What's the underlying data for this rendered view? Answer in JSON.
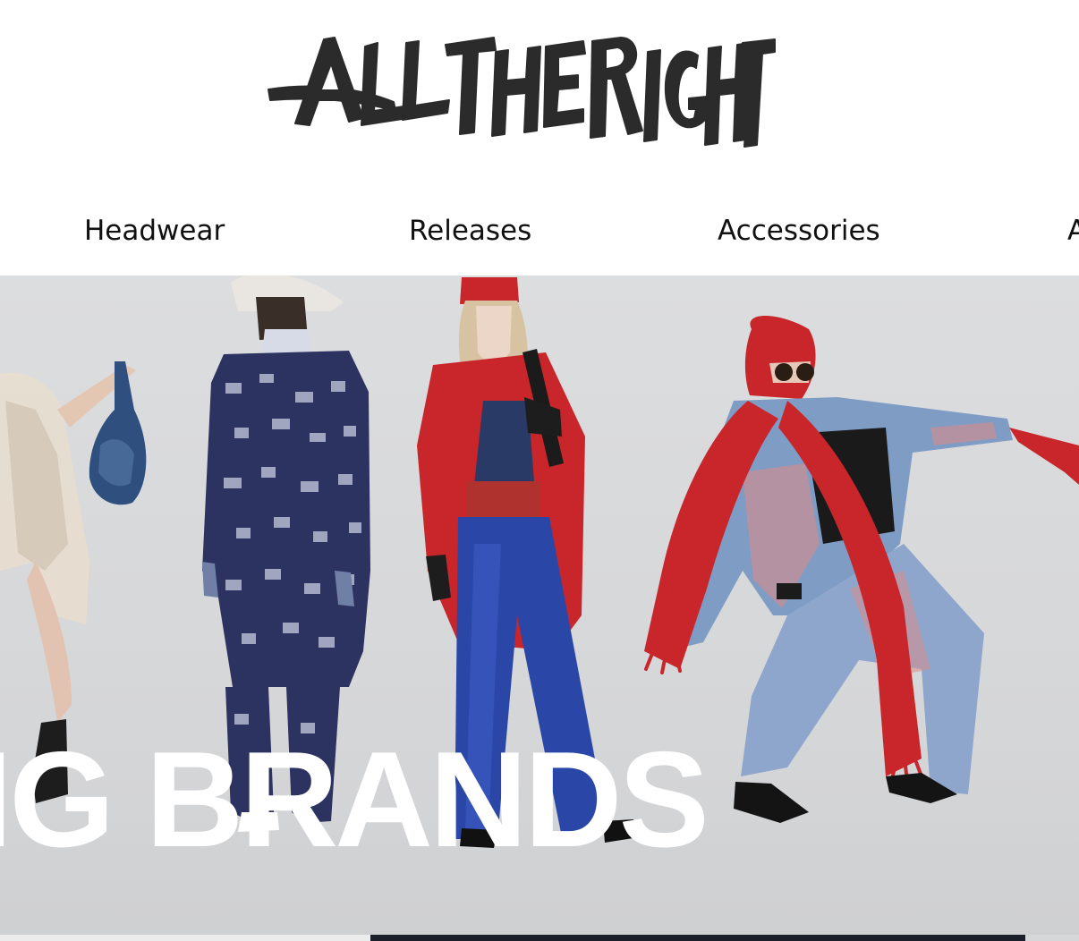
{
  "brand": {
    "logo_text": "ALL THE RIGHT",
    "logo_color": "#2b2b2b"
  },
  "nav": {
    "items": [
      {
        "label": "Headwear"
      },
      {
        "label": "Releases"
      },
      {
        "label": "Accessories"
      },
      {
        "label": "A"
      }
    ]
  },
  "hero": {
    "headline": "IG BRANDS",
    "headline_color": "#ffffff",
    "background_color": "#d9dadc"
  },
  "colors": {
    "red_garment": "#c8262b",
    "blue_trousers": "#2a47a8",
    "denim": "#7f9cc4",
    "pattern_navy": "#2c3360"
  }
}
